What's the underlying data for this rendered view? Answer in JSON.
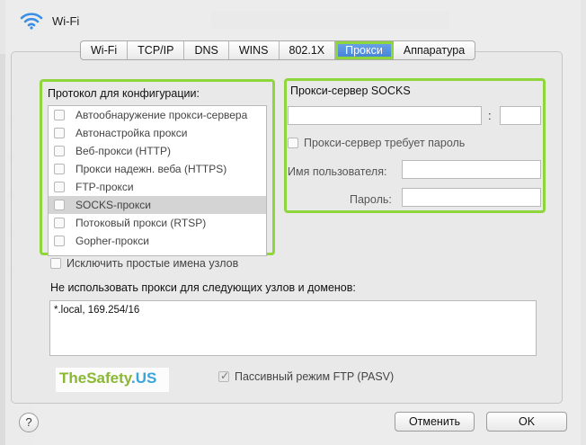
{
  "window": {
    "title": "Wi-Fi"
  },
  "tabs": [
    {
      "label": "Wi-Fi"
    },
    {
      "label": "TCP/IP"
    },
    {
      "label": "DNS"
    },
    {
      "label": "WINS"
    },
    {
      "label": "802.1X"
    },
    {
      "label": "Прокси",
      "active": true
    },
    {
      "label": "Аппаратура"
    }
  ],
  "protocols": {
    "title": "Протокол для конфигурации:",
    "items": [
      {
        "label": "Автообнаружение прокси-сервера",
        "checked": false
      },
      {
        "label": "Автонастройка прокси",
        "checked": false
      },
      {
        "label": "Веб-прокси (HTTP)",
        "checked": false
      },
      {
        "label": "Прокси надежн. веба (HTTPS)",
        "checked": false
      },
      {
        "label": "FTP-прокси",
        "checked": false
      },
      {
        "label": "SOCKS-прокси",
        "checked": false,
        "selected": true
      },
      {
        "label": "Потоковый прокси (RTSP)",
        "checked": false
      },
      {
        "label": "Gopher-прокси",
        "checked": false
      }
    ]
  },
  "socks": {
    "title": "Прокси-сервер SOCKS",
    "server_value": "",
    "port_value": "",
    "colon": ":",
    "requires_password_label": "Прокси-сервер требует пароль",
    "username_label": "Имя пользователя:",
    "username_value": "",
    "password_label": "Пароль:",
    "password_value": ""
  },
  "exclude_simple_label": "Исключить простые имена узлов",
  "bypass": {
    "label": "Не использовать прокси для следующих узлов и доменов:",
    "value": "*.local, 169.254/16"
  },
  "watermark": {
    "part1": "TheSafety",
    "part2": ".US"
  },
  "pasv_label": "Пассивный режим FTP (PASV)",
  "buttons": {
    "help": "?",
    "cancel": "Отменить",
    "ok": "OK"
  },
  "colors": {
    "highlight": "#8fd63c",
    "tab_active": "#3f7fd6"
  }
}
